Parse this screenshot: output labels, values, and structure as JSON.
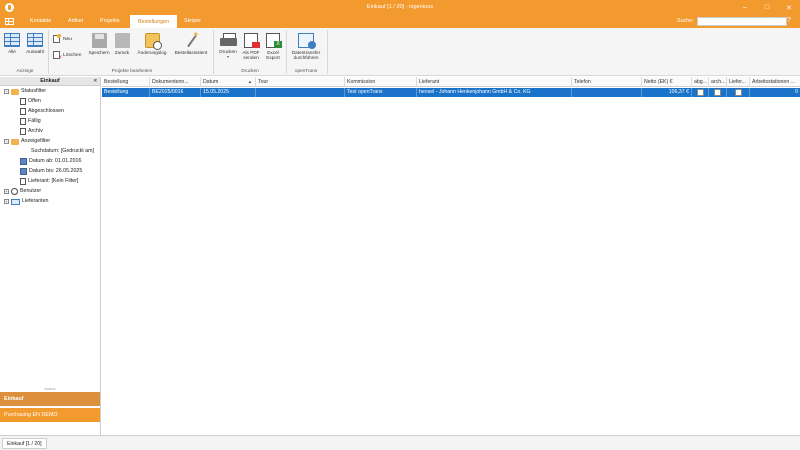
{
  "window": {
    "title": "Einkauf [1 / 20] - ingenious",
    "minimize": "–",
    "maximize": "□",
    "close": "✕"
  },
  "tabs": [
    "Kontakte",
    "Artikel",
    "Projekte",
    "Bestellungen",
    "Skripte"
  ],
  "active_tab": "Bestellungen",
  "search": {
    "label": "Suche:",
    "value": ""
  },
  "toolbar_icons": {
    "settings": "⚙",
    "help": "?"
  },
  "ribbon": {
    "anzeige": {
      "label": "Anzeige",
      "alle": "Alle",
      "auswahl": "Auswahl"
    },
    "bearbeiten": {
      "label": "Projekte bearbeiten",
      "neu": "Neu",
      "loeschen": "Löschen",
      "speichern": "Speichern",
      "zurueck": "Zurück",
      "aenderungslog": "Änderungslog",
      "bestellassistent": "Bestellassistent"
    },
    "drucken": {
      "label": "Drucken",
      "drucken": "Drucken",
      "als_pdf_1": "Als PDF",
      "als_pdf_2": "senden",
      "excel_1": "Excel",
      "excel_2": "Export"
    },
    "opentrans": {
      "label": "openTrans",
      "transfer_1": "Datentransfer",
      "transfer_2": "durchführen"
    }
  },
  "sidebar": {
    "title": "Einkauf",
    "collapse": "«",
    "status_filter": "Statusfilter",
    "status_items": [
      "Offen",
      "Abgeschlossen",
      "Fällig",
      "Archiv"
    ],
    "anzeige_filter": "Anzeigefilter",
    "suchdatum": "Suchdatum: [Gedruckt am]",
    "datum_ab": "Datum ab: 01.01.2016",
    "datum_bis": "Datum bis: 26.05.2025",
    "lieferant": "Lieferant: [Kein Filter]",
    "benutzer": "Benutzer",
    "lieferanten": "Lieferanten",
    "bottom_einkauf": "Einkauf",
    "bottom_purchasing": "Purchasing EN DEMO"
  },
  "grid": {
    "columns": [
      "Bestellung",
      "Dokumentenn...",
      "Datum",
      "Tour",
      "Kommission",
      "Lieferant",
      "Telefon",
      "Netto (EK) €",
      "abg...",
      "arch...",
      "Liefer...",
      "Arbeitsstationen ..."
    ],
    "sort_indicator": "▲",
    "rows": [
      {
        "bestellung": "Bestellung",
        "dokument": "BE2025/0016",
        "datum": "15.05.2025",
        "tour": "",
        "kommission": "Test openTrans",
        "lieferant": "hensel - Johann Henkenjohann GmbH & Co. KG",
        "telefon": "",
        "netto": "106,37 €",
        "arbeitsstationen": "0"
      }
    ]
  },
  "statusbar": {
    "tab": "Einkauf [1 / 20]"
  }
}
